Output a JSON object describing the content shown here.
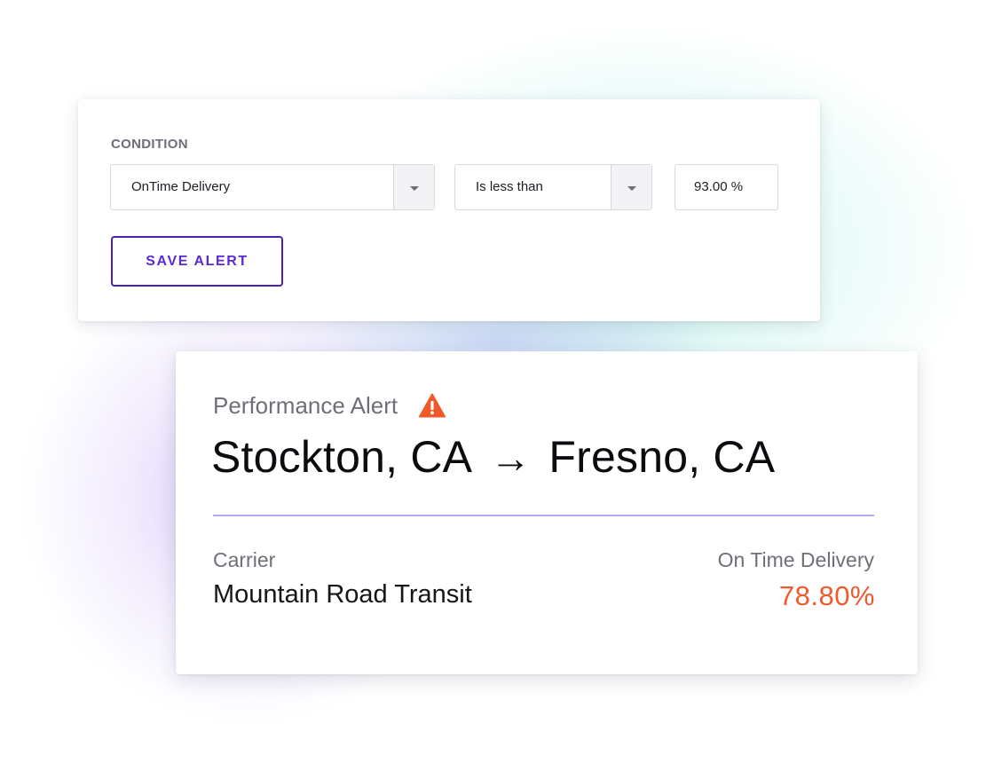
{
  "condition_form": {
    "section_label": "CONDITION",
    "metric_select": {
      "value": "OnTime Delivery"
    },
    "operator_select": {
      "value": "Is less than"
    },
    "threshold_input": {
      "value": "93.00 %"
    },
    "save_button_label": "SAVE ALERT"
  },
  "alert": {
    "title": "Performance Alert",
    "title_icon": "warning-icon",
    "origin": "Stockton, CA",
    "arrow": "→",
    "destination": "Fresno, CA",
    "carrier_label": "Carrier",
    "carrier_value": "Mountain Road Transit",
    "metric_label": "On Time Delivery",
    "metric_value": "78.80%"
  },
  "colors": {
    "accent_purple": "#5a2ad4",
    "alert_orange": "#ee5a2b",
    "divider": "#b8a9ee"
  }
}
